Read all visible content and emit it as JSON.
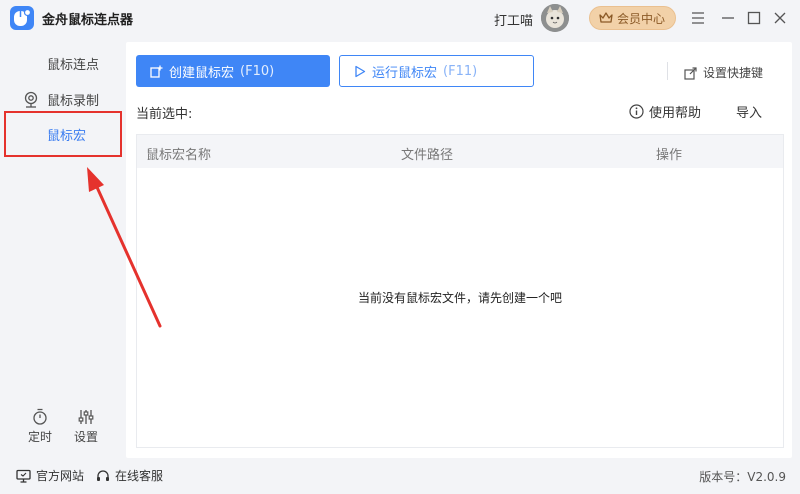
{
  "app": {
    "title": "金舟鼠标连点器",
    "username": "打工喵",
    "vip_label": "会员中心"
  },
  "sidebar": {
    "items": [
      {
        "label": "鼠标连点",
        "icon": "",
        "active": false
      },
      {
        "label": "鼠标录制",
        "icon": "camera-icon",
        "active": false
      },
      {
        "label": "鼠标宏",
        "icon": "",
        "active": true
      }
    ],
    "bottom": [
      {
        "label": "定时",
        "icon": "timer-icon"
      },
      {
        "label": "设置",
        "icon": "sliders-icon"
      }
    ]
  },
  "toolbar": {
    "create_label": "创建鼠标宏",
    "create_key": "(F10)",
    "run_label": "运行鼠标宏",
    "run_key": "(F11)",
    "shortcut_label": "设置快捷键"
  },
  "main": {
    "current_label": "当前选中:",
    "help_label": "使用帮助",
    "import_label": "导入"
  },
  "table": {
    "columns": [
      "鼠标宏名称",
      "文件路径",
      "操作"
    ],
    "empty_message": "当前没有鼠标宏文件，请先创建一个吧"
  },
  "footer": {
    "website_label": "官方网站",
    "service_label": "在线客服",
    "version": "版本号：V2.0.9"
  },
  "colors": {
    "accent": "#3f86f6",
    "annotation_red": "#e5322d",
    "vip_bg": "#f2d1a8"
  }
}
